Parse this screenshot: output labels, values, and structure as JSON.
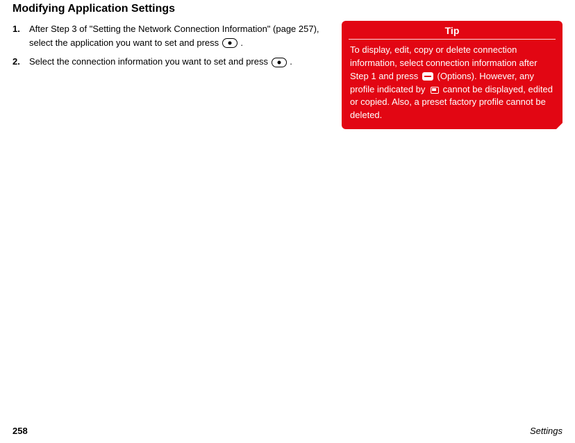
{
  "heading": "Modifying Application Settings",
  "steps": [
    {
      "num": "1.",
      "pre": "After Step 3 of \"Setting the Network Connection Information\" (page 257), select the application you want to set and press ",
      "post": "."
    },
    {
      "num": "2.",
      "pre": "Select the connection information you want to set and press ",
      "post": "."
    }
  ],
  "tip": {
    "title": "Tip",
    "part1": "To display, edit, copy or delete connection information, select connection information after Step 1 and press ",
    "options_label": " (Options). However, any profile indicated by ",
    "part3": " cannot be displayed, edited or copied. Also, a preset factory profile cannot be deleted."
  },
  "footer": {
    "page_number": "258",
    "section": "Settings"
  }
}
